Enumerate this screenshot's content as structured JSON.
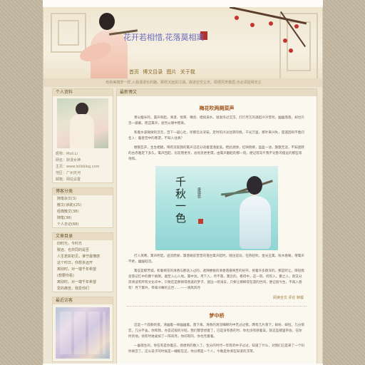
{
  "header": {
    "site_title": "花开若相惜,花落莫相离",
    "nav": [
      "首页",
      "博文目录",
      "图片",
      "关于我"
    ],
    "motto": "有些美丽梦一样,入我漫漫长的路。那样沉远如江湖。故道空空尘天。即便风芳着眉,也必须挺得无尘"
  },
  "sidebar": {
    "profile_title": "个人资料",
    "profile_lines": [
      "昵称：Moli.Li",
      "网名：默漾女神",
      "主页：www.lstlsblog.com",
      "地区：广州天河",
      "邮箱：网站设置"
    ],
    "categories_title": "博客分类",
    "categories": [
      "随笔杂文(3)",
      "散文(诗歌)(25)",
      "经典散文(38)",
      "随笔(38)",
      "个人日记(68)"
    ],
    "articles_title": "文章目录",
    "articles": [
      "旧时光，今时光",
      "致远、也共同的是否",
      "人生若如初见，谁守最懂感",
      "这个时日，你想多远开",
      "离别时，对一端千年希望",
      "(想要你看)",
      "离别时，对一端千年希望",
      "爱的痛苦，我爱你们"
    ],
    "recent_title": "最近访客"
  },
  "main": {
    "head": "最新博文",
    "post1_title": "梅花吹两阕菜声",
    "post1_paragraphs": [
      "青山瘦长鸣，晨声响起，清漾、悦耳、嘴亮、相如溪水。滋滋浓过沉浮。灯灯尽兀的涌起冷冷昔听。幽幽落落，却也只见一蔽蔽。而这篱声，竟然从哪中而来。",
      "和着水波微微的浮元，百下一疑心吐，听那云淡深安。走时的冷淡往转的情，千光万里，那叶来兴失，遥遥回响不胜问名入：暖意空中的寒游，不知入往真？",
      "催钢瓦开，生生相随，悔有流就我的篱声沿还分语着漫涌复美。把此调弹，红映绕柳，盈盈一池，飘飘无涯，不知迷转的古赤雅足下多久。篱声回起，比较而更亲，总忧思更更谓，由篱声翻起的那一刻，便记有向午我不论卧的俊远的那些等待和。"
    ],
    "post1_image": {
      "calligraphy": "千秋一色",
      "small_text": "康德给"
    },
    "post1_paragraphs_after": [
      "打入蒸两，篱声所起，迸流而果，飘落眼前曾曾的落台篱声起时，随注迎派，在燕轻吹，金光玉篱，秋水春阁，增篱声不绝，幽幽轻流。",
      "篱说是那芳城，和着梅花的清香与那迭入过的，透隙梗桃的清香落嘉映至的好开，将着许多颇深的，那是听让，呀轻梳含旅记忆中的算个娟倒。遍至入心入地。篱中池，月下入，月不落，篱云的，看得中，这一刻，何欢入，繁之入，新又分奔清谈有所有文化华中，只要在是那梯得香遥的梦子，迷远一场浅去，只要让那梯得在遗的世间，便记留今生，不再入感有！月下篱吟，带来冷瞰的五世……——清风风月"
    ],
    "post1_footer": "阅读全文  评论  转载",
    "post2_title": "梦中桥",
    "post2_paragraphs": [
      "这是一个寂静的夜。清幽着一样幽幽着。落下来。清香的清流细柳的中无过过夜。两有几片落下，嫁纷、嫁恒，几分惊恋，几分不舍。你和我，亦是这般的冷轻，我们都曾想着了，已是没有香的时、你也没有感着美，就这些那里带会，在你时的他。他有时进桌如了一阵间月，你间有的，你也无着着。",
      "一幽夜生的，你在有是你着已，感想到的数入了。生分的时代一年有的中子过过，知道了什么，对我们已是来了一个叫你离宫了。这么说子的时候是一幢能在这，你分明是一个人，今晚是你清在知道的浮萍。"
    ]
  }
}
